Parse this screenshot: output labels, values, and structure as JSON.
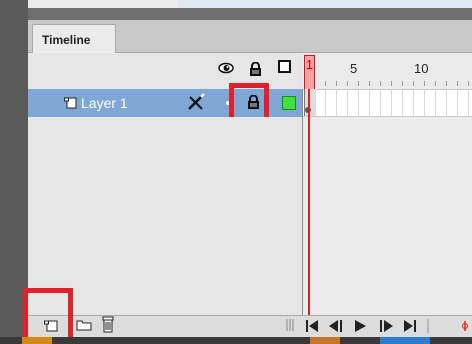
{
  "panel": {
    "tab_label": "Timeline"
  },
  "ruler": {
    "labels": [
      "1",
      "5",
      "10"
    ]
  },
  "layer": {
    "name": "Layer 1",
    "outline_color": "#3fe13f"
  },
  "colors": {
    "layer_row_selected": "#7fa7d6",
    "playhead": "#e02020",
    "highlight": "#e0202a"
  },
  "icons": {
    "header": [
      "eye-icon",
      "lock-icon",
      "outline-icon"
    ],
    "row": [
      "layer-icon",
      "pencil-icon",
      "lock-icon"
    ],
    "bottom": [
      "new-layer-icon",
      "new-folder-icon",
      "trash-icon"
    ],
    "transport": [
      "first-frame-icon",
      "step-back-icon",
      "play-icon",
      "step-forward-icon",
      "last-frame-icon"
    ]
  }
}
